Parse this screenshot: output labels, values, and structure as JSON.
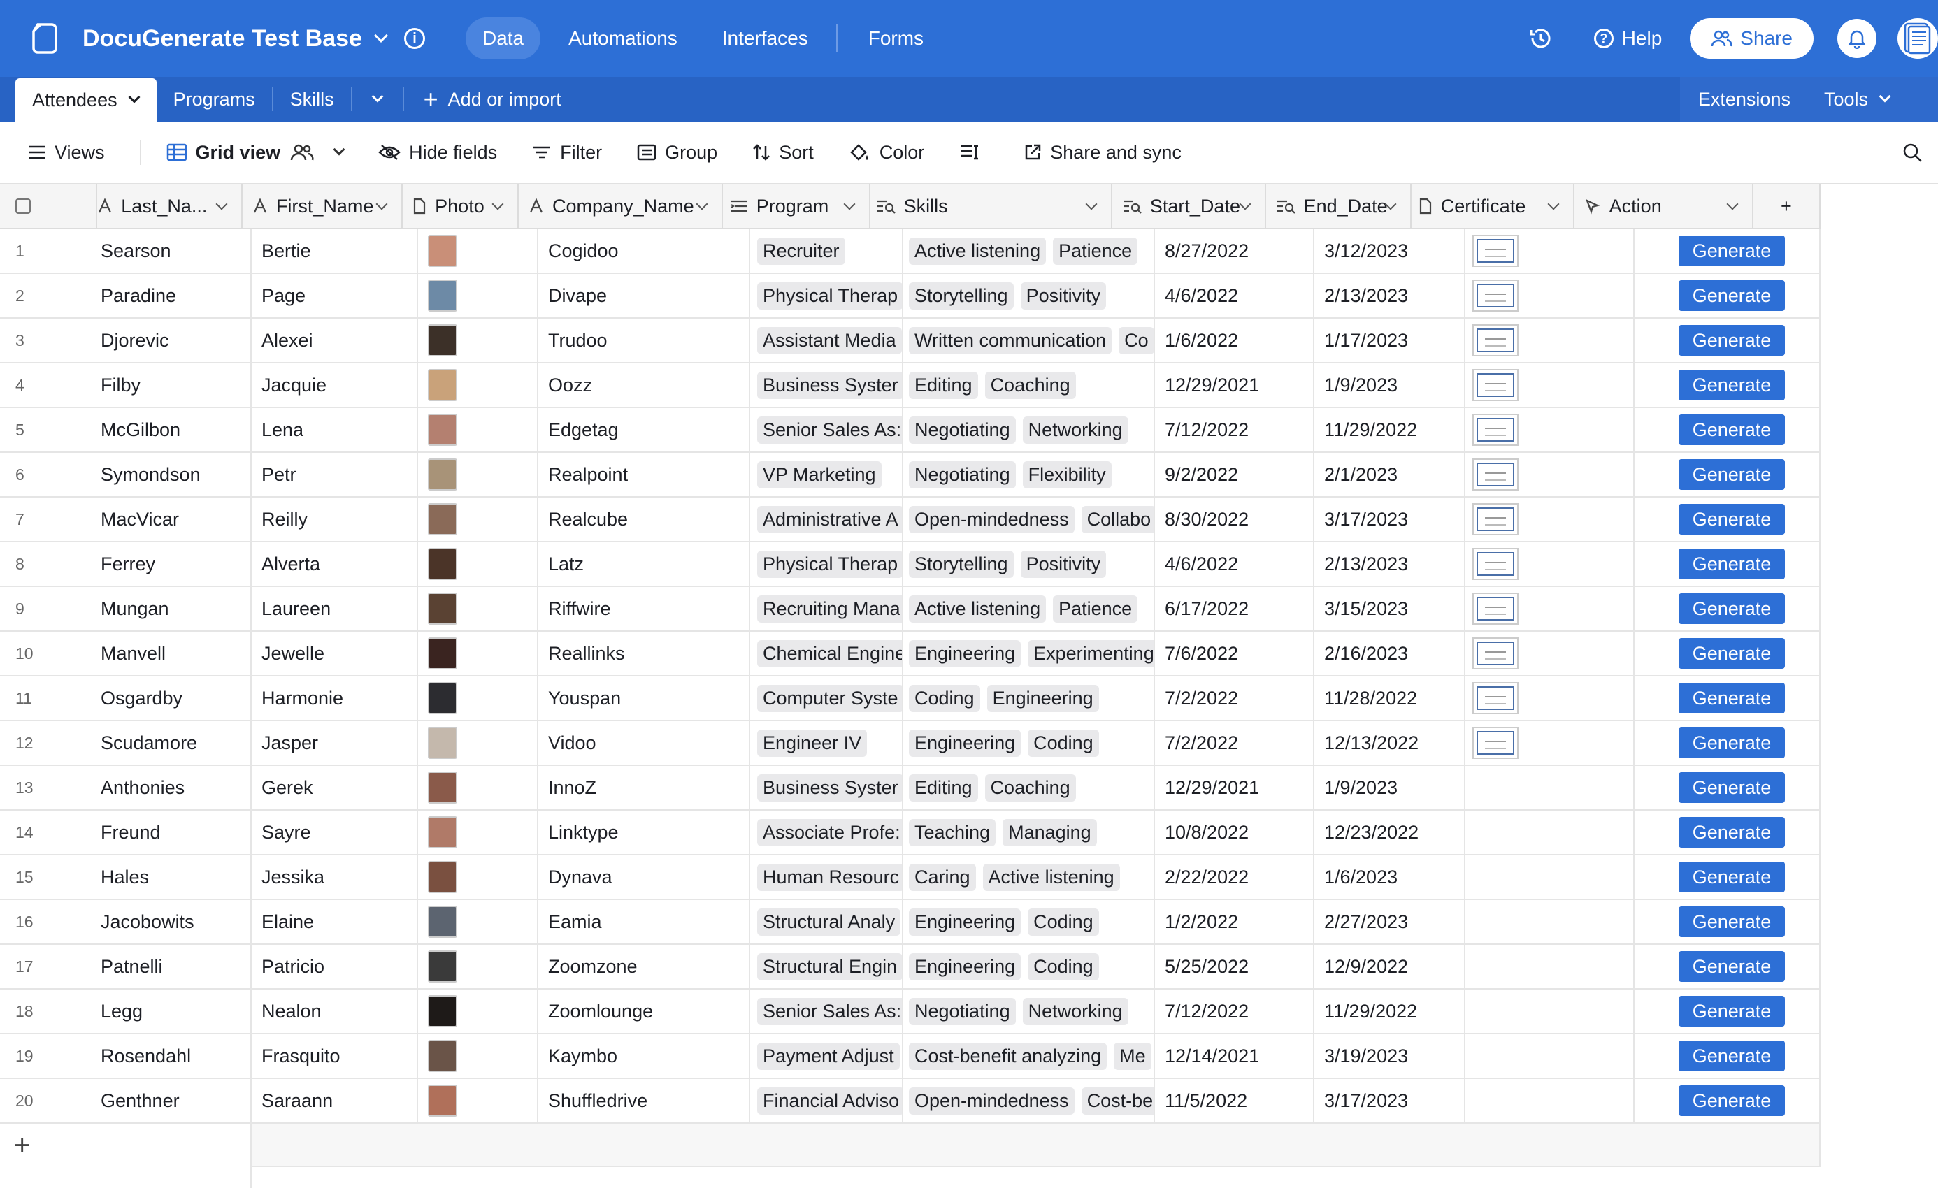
{
  "app": {
    "base_title": "DocuGenerate Test Base",
    "nav": [
      "Data",
      "Automations",
      "Interfaces",
      "Forms"
    ],
    "help_label": "Help",
    "share_label": "Share"
  },
  "tables": {
    "active": "Attendees",
    "others": [
      "Programs",
      "Skills"
    ],
    "add_import": "Add or import",
    "extensions": "Extensions",
    "tools": "Tools"
  },
  "toolbar": {
    "views": "Views",
    "grid_view": "Grid view",
    "hide_fields": "Hide fields",
    "filter": "Filter",
    "group": "Group",
    "sort": "Sort",
    "color": "Color",
    "share_sync": "Share and sync"
  },
  "columns": {
    "last": "Last_Na...",
    "first": "First_Name",
    "photo": "Photo",
    "company": "Company_Name",
    "program": "Program",
    "skills": "Skills",
    "start": "Start_Date",
    "end": "End_Date",
    "cert": "Certificate",
    "action": "Action"
  },
  "button_label": "Generate",
  "rows": [
    {
      "n": "1",
      "last": "Searson",
      "first": "Bertie",
      "company": "Cogidoo",
      "program": "Recruiter",
      "skills": [
        "Active listening",
        "Patience"
      ],
      "start": "8/27/2022",
      "end": "3/12/2023",
      "cert": true,
      "photo": "#c98f78"
    },
    {
      "n": "2",
      "last": "Paradine",
      "first": "Page",
      "company": "Divape",
      "program": "Physical Therap",
      "skills": [
        "Storytelling",
        "Positivity"
      ],
      "start": "4/6/2022",
      "end": "2/13/2023",
      "cert": true,
      "photo": "#6d8aa6"
    },
    {
      "n": "3",
      "last": "Djorevic",
      "first": "Alexei",
      "company": "Trudoo",
      "program": "Assistant Media",
      "skills": [
        "Written communication",
        "Co"
      ],
      "start": "1/6/2022",
      "end": "1/17/2023",
      "cert": true,
      "photo": "#3c3028"
    },
    {
      "n": "4",
      "last": "Filby",
      "first": "Jacquie",
      "company": "Oozz",
      "program": "Business Syster",
      "skills": [
        "Editing",
        "Coaching"
      ],
      "start": "12/29/2021",
      "end": "1/9/2023",
      "cert": true,
      "photo": "#c9a27a"
    },
    {
      "n": "5",
      "last": "McGilbon",
      "first": "Lena",
      "company": "Edgetag",
      "program": "Senior Sales As:",
      "skills": [
        "Negotiating",
        "Networking"
      ],
      "start": "7/12/2022",
      "end": "11/29/2022",
      "cert": true,
      "photo": "#b48070"
    },
    {
      "n": "6",
      "last": "Symondson",
      "first": "Petr",
      "company": "Realpoint",
      "program": "VP Marketing",
      "skills": [
        "Negotiating",
        "Flexibility"
      ],
      "start": "9/2/2022",
      "end": "2/1/2023",
      "cert": true,
      "photo": "#a89378"
    },
    {
      "n": "7",
      "last": "MacVicar",
      "first": "Reilly",
      "company": "Realcube",
      "program": "Administrative A",
      "skills": [
        "Open-mindedness",
        "Collabo"
      ],
      "start": "8/30/2022",
      "end": "3/17/2023",
      "cert": true,
      "photo": "#8a6a58"
    },
    {
      "n": "8",
      "last": "Ferrey",
      "first": "Alverta",
      "company": "Latz",
      "program": "Physical Therap",
      "skills": [
        "Storytelling",
        "Positivity"
      ],
      "start": "4/6/2022",
      "end": "2/13/2023",
      "cert": true,
      "photo": "#4b3428"
    },
    {
      "n": "9",
      "last": "Mungan",
      "first": "Laureen",
      "company": "Riffwire",
      "program": "Recruiting Mana",
      "skills": [
        "Active listening",
        "Patience"
      ],
      "start": "6/17/2022",
      "end": "3/15/2023",
      "cert": true,
      "photo": "#5a4233"
    },
    {
      "n": "10",
      "last": "Manvell",
      "first": "Jewelle",
      "company": "Reallinks",
      "program": "Chemical Engine",
      "skills": [
        "Engineering",
        "Experimenting"
      ],
      "start": "7/6/2022",
      "end": "2/16/2023",
      "cert": true,
      "photo": "#3a2420"
    },
    {
      "n": "11",
      "last": "Osgardby",
      "first": "Harmonie",
      "company": "Youspan",
      "program": "Computer Syste",
      "skills": [
        "Coding",
        "Engineering"
      ],
      "start": "7/2/2022",
      "end": "11/28/2022",
      "cert": true,
      "photo": "#2c2c30"
    },
    {
      "n": "12",
      "last": "Scudamore",
      "first": "Jasper",
      "company": "Vidoo",
      "program": "Engineer IV",
      "skills": [
        "Engineering",
        "Coding"
      ],
      "start": "7/2/2022",
      "end": "12/13/2022",
      "cert": true,
      "photo": "#c4b8ac"
    },
    {
      "n": "13",
      "last": "Anthonies",
      "first": "Gerek",
      "company": "InnoZ",
      "program": "Business Syster",
      "skills": [
        "Editing",
        "Coaching"
      ],
      "start": "12/29/2021",
      "end": "1/9/2023",
      "cert": false,
      "photo": "#8a5a4a"
    },
    {
      "n": "14",
      "last": "Freund",
      "first": "Sayre",
      "company": "Linktype",
      "program": "Associate Profe:",
      "skills": [
        "Teaching",
        "Managing"
      ],
      "start": "10/8/2022",
      "end": "12/23/2022",
      "cert": false,
      "photo": "#b07a68"
    },
    {
      "n": "15",
      "last": "Hales",
      "first": "Jessika",
      "company": "Dynava",
      "program": "Human Resourc",
      "skills": [
        "Caring",
        "Active listening"
      ],
      "start": "2/22/2022",
      "end": "1/6/2023",
      "cert": false,
      "photo": "#7a5040"
    },
    {
      "n": "16",
      "last": "Jacobowits",
      "first": "Elaine",
      "company": "Eamia",
      "program": "Structural Analy",
      "skills": [
        "Engineering",
        "Coding"
      ],
      "start": "1/2/2022",
      "end": "2/27/2023",
      "cert": false,
      "photo": "#5c6470"
    },
    {
      "n": "17",
      "last": "Patnelli",
      "first": "Patricio",
      "company": "Zoomzone",
      "program": "Structural Engin",
      "skills": [
        "Engineering",
        "Coding"
      ],
      "start": "5/25/2022",
      "end": "12/9/2022",
      "cert": false,
      "photo": "#3a3a3a"
    },
    {
      "n": "18",
      "last": "Legg",
      "first": "Nealon",
      "company": "Zoomlounge",
      "program": "Senior Sales As:",
      "skills": [
        "Negotiating",
        "Networking"
      ],
      "start": "7/12/2022",
      "end": "11/29/2022",
      "cert": false,
      "photo": "#1e1a18"
    },
    {
      "n": "19",
      "last": "Rosendahl",
      "first": "Frasquito",
      "company": "Kaymbo",
      "program": "Payment Adjust",
      "skills": [
        "Cost-benefit analyzing",
        "Me"
      ],
      "start": "12/14/2021",
      "end": "3/19/2023",
      "cert": false,
      "photo": "#6a5448"
    },
    {
      "n": "20",
      "last": "Genthner",
      "first": "Saraann",
      "company": "Shuffledrive",
      "program": "Financial Adviso",
      "skills": [
        "Open-mindedness",
        "Cost-be"
      ],
      "start": "11/5/2022",
      "end": "3/17/2023",
      "cert": false,
      "photo": "#b0705a"
    }
  ]
}
